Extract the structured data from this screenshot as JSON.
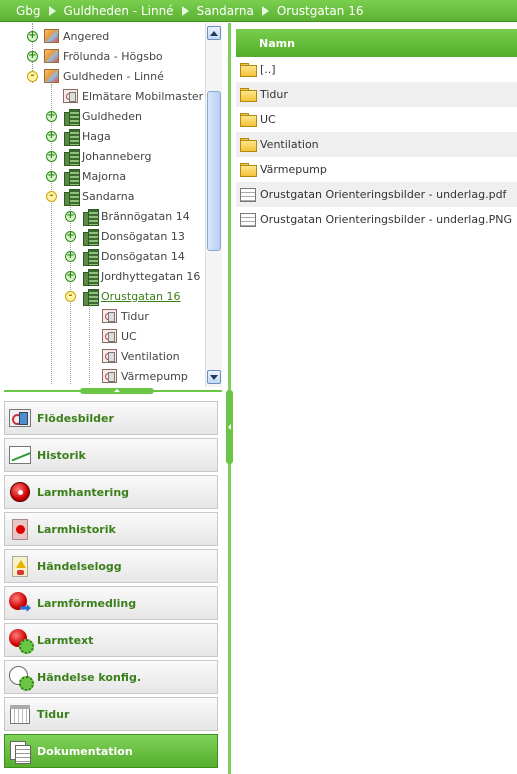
{
  "breadcrumb": {
    "items": [
      "Gbg",
      "Guldheden - Linné",
      "Sandarna",
      "Orustgatan 16"
    ]
  },
  "tree": {
    "nodes": [
      {
        "label": "Angered",
        "toggle": "+",
        "icon": "map-icon"
      },
      {
        "label": "Frölunda - Högsbo",
        "toggle": "+",
        "icon": "map-icon"
      },
      {
        "label": "Guldheden - Linné",
        "toggle": "-",
        "icon": "map-icon"
      },
      {
        "label": "Elmätare Mobilmaster",
        "toggle": "",
        "icon": "flow-icon"
      },
      {
        "label": "Guldheden",
        "toggle": "+",
        "icon": "building-icon"
      },
      {
        "label": "Haga",
        "toggle": "+",
        "icon": "building-icon"
      },
      {
        "label": "Johanneberg",
        "toggle": "+",
        "icon": "building-icon"
      },
      {
        "label": "Majorna",
        "toggle": "+",
        "icon": "building-icon"
      },
      {
        "label": "Sandarna",
        "toggle": "-",
        "icon": "building-icon"
      },
      {
        "label": "Brännögatan 14",
        "toggle": "+",
        "icon": "building-icon"
      },
      {
        "label": "Donsögatan 13",
        "toggle": "+",
        "icon": "building-icon"
      },
      {
        "label": "Donsögatan 14",
        "toggle": "+",
        "icon": "building-icon"
      },
      {
        "label": "Jordhyttegatan 16",
        "toggle": "+",
        "icon": "building-icon"
      },
      {
        "label": "Orustgatan 16",
        "toggle": "-",
        "icon": "building-icon"
      },
      {
        "label": "Tidur",
        "toggle": "",
        "icon": "flow-icon"
      },
      {
        "label": "UC",
        "toggle": "",
        "icon": "flow-icon"
      },
      {
        "label": "Ventilation",
        "toggle": "",
        "icon": "flow-icon"
      },
      {
        "label": "Värmepump",
        "toggle": "",
        "icon": "flow-icon"
      }
    ],
    "selected": "Orustgatan 16"
  },
  "menu": {
    "items": [
      {
        "label": "Flödesbilder",
        "icon": "flow-diagram-icon"
      },
      {
        "label": "Historik",
        "icon": "history-chart-icon"
      },
      {
        "label": "Larmhantering",
        "icon": "alarm-icon"
      },
      {
        "label": "Larmhistorik",
        "icon": "alarm-history-icon"
      },
      {
        "label": "Händelselogg",
        "icon": "event-log-icon"
      },
      {
        "label": "Larmförmedling",
        "icon": "alarm-forward-icon"
      },
      {
        "label": "Larmtext",
        "icon": "alarm-text-icon"
      },
      {
        "label": "Händelse konfig.",
        "icon": "event-config-icon"
      },
      {
        "label": "Tidur",
        "icon": "calendar-icon"
      },
      {
        "label": "Dokumentation",
        "icon": "documents-icon"
      }
    ],
    "active": "Dokumentation"
  },
  "files": {
    "header": "Namn",
    "rows": [
      {
        "name": "[..]",
        "type": "folder"
      },
      {
        "name": "Tidur",
        "type": "folder"
      },
      {
        "name": "UC",
        "type": "folder"
      },
      {
        "name": "Ventilation",
        "type": "folder"
      },
      {
        "name": "Värmepump",
        "type": "folder"
      },
      {
        "name": "Orustgatan Orienteringsbilder - underlag.pdf",
        "type": "document"
      },
      {
        "name": "Orustgatan Orienteringsbilder - underlag.PNG",
        "type": "document"
      }
    ]
  },
  "colors": {
    "accent_green": "#5db233",
    "link_green": "#3a7f1a",
    "scrollbar_blue": "#6a8ec0"
  }
}
